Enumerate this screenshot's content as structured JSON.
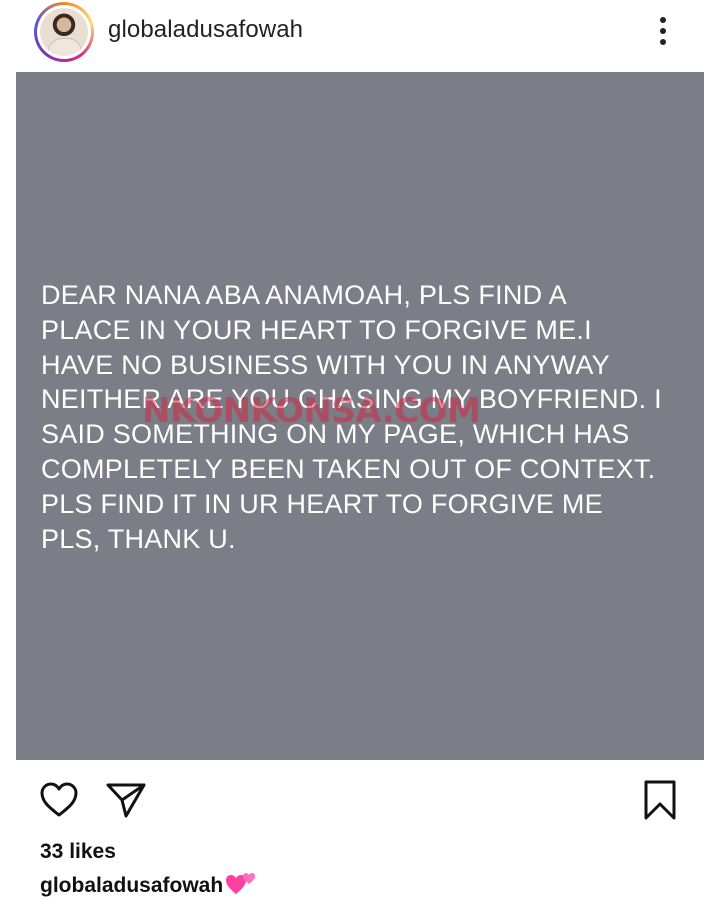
{
  "post": {
    "username": "globaladusafowah",
    "image_text": "DEAR NANA ABA ANAMOAH, PLS FIND A\nPLACE IN YOUR HEART TO FORGIVE ME.I\nHAVE NO BUSINESS WITH YOU IN ANYWAY\nNEITHER ARE YOU CHASING MY BOYFRIEND. I\nSAID SOMETHING ON MY PAGE, WHICH HAS\nCOMPLETELY BEEN TAKEN OUT OF CONTEXT.\nPLS FIND IT IN UR HEART TO FORGIVE ME\nPLS, THANK U.",
    "image_bg_color": "#7b7e86",
    "watermark_text": "NKONKONSA.COM",
    "likes": "33 likes",
    "caption_user": "globaladusafowah",
    "caption_emoji": "two-hearts-icon"
  },
  "icons": {
    "more": "more-vertical-icon",
    "like": "heart-outline-icon",
    "share": "paper-plane-icon",
    "save": "bookmark-icon"
  }
}
